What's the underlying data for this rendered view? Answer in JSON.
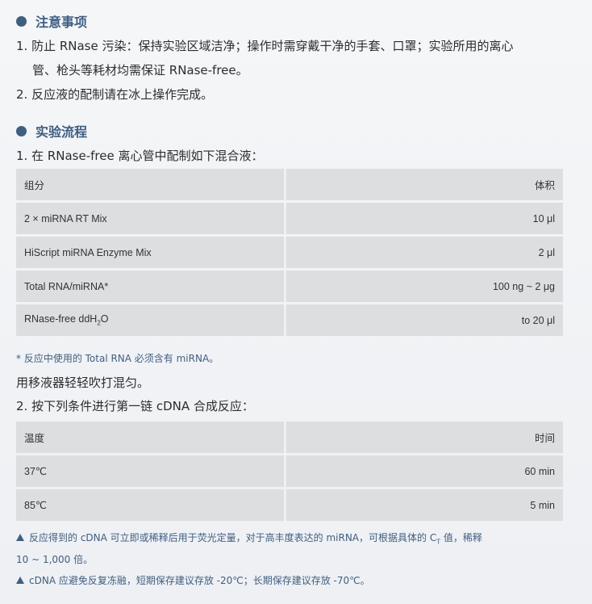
{
  "precautions": {
    "title": "注意事项",
    "item1_line1": "1. 防止 RNase 污染：保持实验区域洁净；操作时需穿戴干净的手套、口罩；实验所用的离心",
    "item1_line2": "管、枪头等耗材均需保证 RNase-free。",
    "item2": "2. 反应液的配制请在冰上操作完成。"
  },
  "workflow": {
    "title": "实验流程",
    "step1": "1. 在 RNase-free 离心管中配制如下混合液：",
    "table1": {
      "header": [
        "组分",
        "体积"
      ],
      "rows": [
        [
          "2 × miRNA RT Mix",
          "10 μl"
        ],
        [
          "HiScript miRNA Enzyme Mix",
          "2 μl"
        ],
        [
          "Total RNA/miRNA*",
          "100 ng ~ 2 μg"
        ],
        [
          "RNase-free ddH",
          "to 20 μl"
        ]
      ],
      "row4_sub": "2",
      "row4_tail": "O"
    },
    "footnote": "* 反应中使用的 Total RNA 必须含有 miRNA。",
    "mix_text": "用移液器轻轻吹打混匀。",
    "step2": "2. 按下列条件进行第一链 cDNA 合成反应：",
    "table2": {
      "header": [
        "温度",
        "时间"
      ],
      "rows": [
        [
          "37℃",
          "60 min"
        ],
        [
          "85℃",
          "5 min"
        ]
      ]
    },
    "note1_a": "反应得到的 cDNA 可立即或稀释后用于荧光定量，对于高丰度表达的 miRNA，可根据具体的 C",
    "note1_sub": "T",
    "note1_b": " 值，稀释",
    "note1_line2": "10 ~ 1,000 倍。",
    "note2": "cDNA 应避免反复冻融，短期保存建议存放 -20℃；长期保存建议存放 -70℃。"
  },
  "colors": {
    "accent": "#3d5f83",
    "cell_bg": "#dcdedf",
    "page_bg": "#f2f3f5"
  }
}
